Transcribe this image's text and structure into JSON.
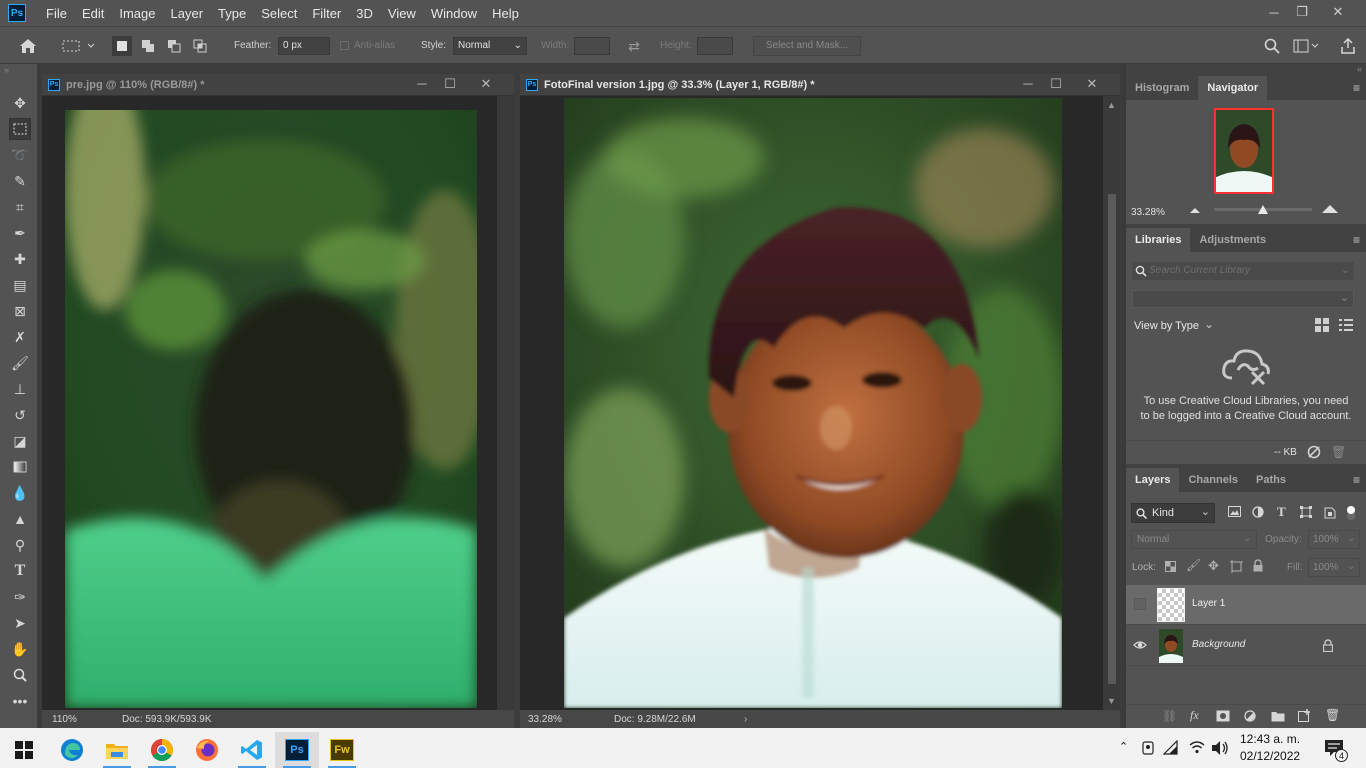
{
  "app": {
    "logo": "Ps",
    "brand_color": "#31a8ff"
  },
  "menu": [
    "File",
    "Edit",
    "Image",
    "Layer",
    "Type",
    "Select",
    "Filter",
    "3D",
    "View",
    "Window",
    "Help"
  ],
  "window_controls": {
    "minimize": "─",
    "restore": "❐",
    "close": "✕"
  },
  "options_bar": {
    "feather_label": "Feather:",
    "feather_value": "0 px",
    "antialias_label": "Anti-alias",
    "style_label": "Style:",
    "style_value": "Normal",
    "width_label": "Width:",
    "height_label": "Height:",
    "select_mask_label": "Select and Mask..."
  },
  "documents": [
    {
      "title": "pre.jpg @ 110% (RGB/8#) *",
      "zoom": "110%",
      "doc_info": "Doc: 593.9K/593.9K",
      "active": false
    },
    {
      "title": "FotoFinal version 1.jpg @ 33.3% (Layer 1, RGB/8#) *",
      "zoom": "33.28%",
      "doc_info": "Doc: 9.28M/22.6M",
      "active": true
    }
  ],
  "navigator_panel": {
    "tabs": [
      "Histogram",
      "Navigator"
    ],
    "active_tab": "Navigator",
    "zoom": "33.28%",
    "zoom_slider_fraction": 0.5
  },
  "libraries_panel": {
    "tabs": [
      "Libraries",
      "Adjustments"
    ],
    "active_tab": "Libraries",
    "search_placeholder": "Search Current Library",
    "view_by": "View by Type",
    "message": "To use Creative Cloud Libraries, you need to be logged into a Creative Cloud account.",
    "storage": "-- KB"
  },
  "layers_panel": {
    "tabs": [
      "Layers",
      "Channels",
      "Paths"
    ],
    "active_tab": "Layers",
    "filter_kind": "Kind",
    "blend_mode": "Normal",
    "opacity_label": "Opacity:",
    "opacity_value": "100%",
    "lock_label": "Lock:",
    "fill_label": "Fill:",
    "fill_value": "100%",
    "layers": [
      {
        "name": "Layer 1",
        "visible": false,
        "selected": true,
        "locked": false
      },
      {
        "name": "Background",
        "visible": true,
        "selected": false,
        "locked": true
      }
    ]
  },
  "taskbar": {
    "apps": [
      "windows-start",
      "edge",
      "file-explorer",
      "chrome",
      "firefox",
      "vscode",
      "photoshop",
      "fireworks"
    ],
    "ps_label": "Ps",
    "fw_label": "Fw",
    "time": "12:43 a. m.",
    "date": "02/12/2022",
    "notifications": "4"
  }
}
